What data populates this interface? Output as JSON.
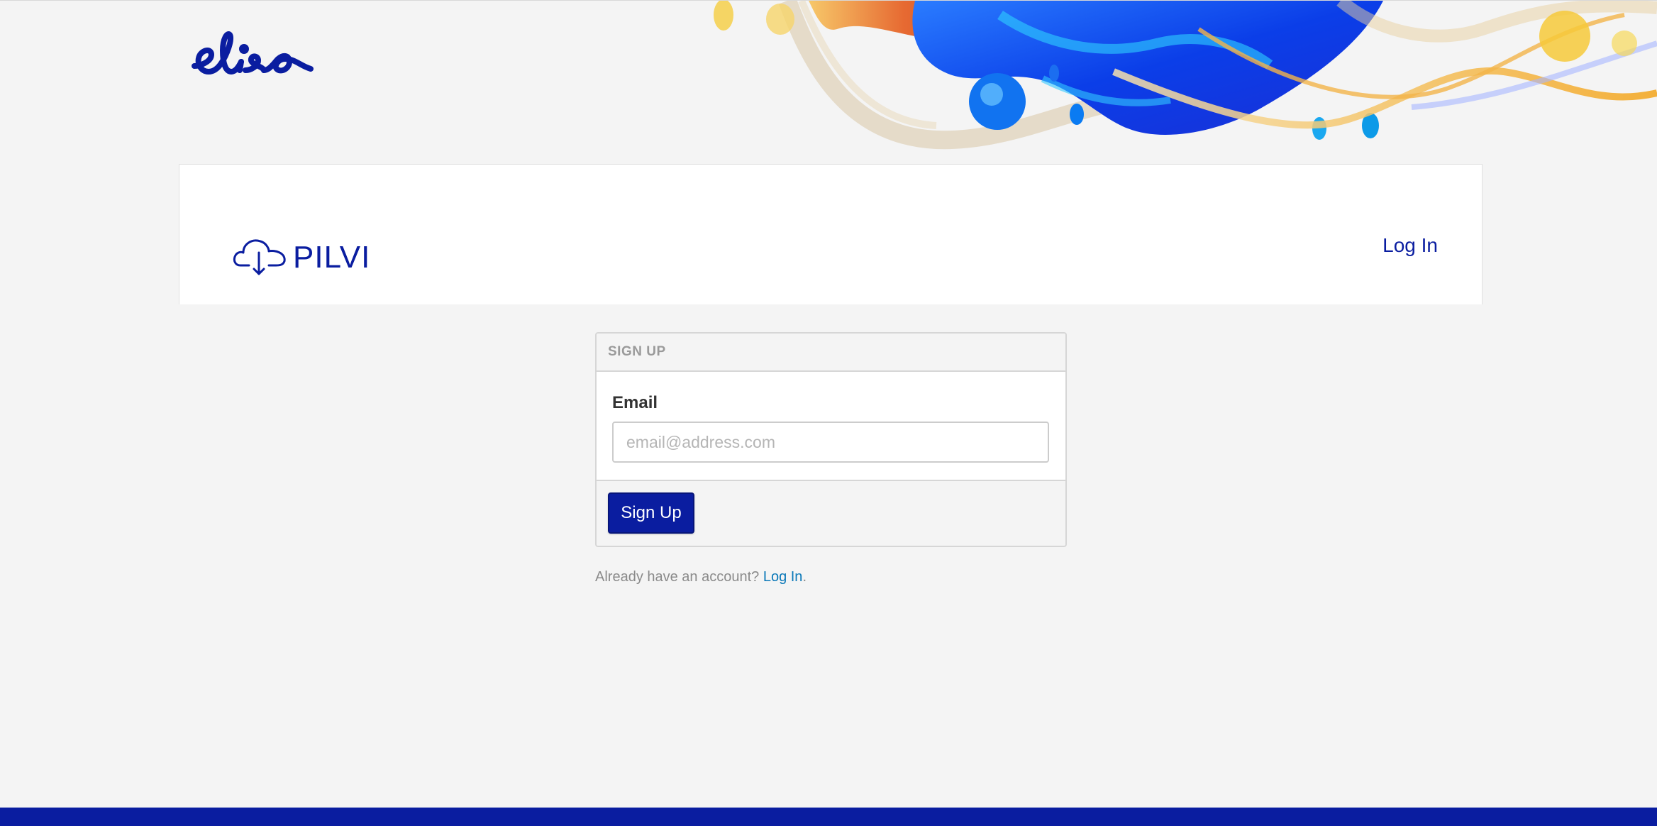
{
  "brand": {
    "company_logo": "elisa",
    "product_logo_text": "PILVI",
    "product_icon": "cloud-download-icon",
    "accent_color": "#0a1da0"
  },
  "header": {
    "login_link": "Log In"
  },
  "signup_panel": {
    "heading": "SIGN UP",
    "email_label": "Email",
    "email_placeholder": "email@address.com",
    "email_value": "",
    "submit_label": "Sign Up"
  },
  "footer_note": {
    "prefix": "Already have an account?",
    "link": "Log In",
    "suffix": "."
  }
}
